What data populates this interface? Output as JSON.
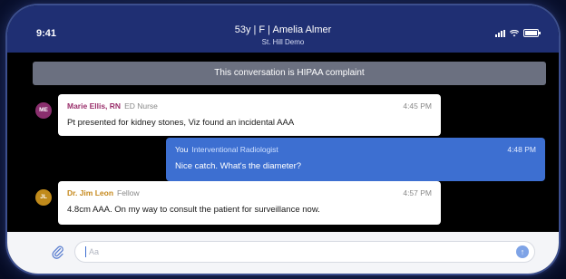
{
  "status": {
    "time": "9:41"
  },
  "header": {
    "title": "53y | F | Amelia Almer",
    "subtitle": "St. Hill Demo"
  },
  "banner": {
    "text": "This conversation is HIPAA complaint"
  },
  "messages": [
    {
      "avatar": "ME",
      "sender": "Marie Ellis, RN",
      "role": "ED Nurse",
      "time": "4:45 PM",
      "text": "Pt presented for kidney stones, Viz found an incidental AAA",
      "direction": "incoming"
    },
    {
      "sender": "You",
      "role": "Interventional Radiologist",
      "time": "4:48 PM",
      "text": "Nice catch. What's the diameter?",
      "direction": "outgoing"
    },
    {
      "avatar": "JL",
      "sender": "Dr. Jim Leon",
      "role": "Fellow",
      "time": "4:57 PM",
      "text": "4.8cm AAA. On my way to consult the patient for surveillance now.",
      "direction": "incoming"
    }
  ],
  "composer": {
    "placeholder": "Aa",
    "icons": [
      "paperclip-icon",
      "send-icon"
    ]
  },
  "colors": {
    "header": "#1f2f73",
    "outgoing_bubble": "#3d6fd1",
    "banner": "#6b7080"
  }
}
